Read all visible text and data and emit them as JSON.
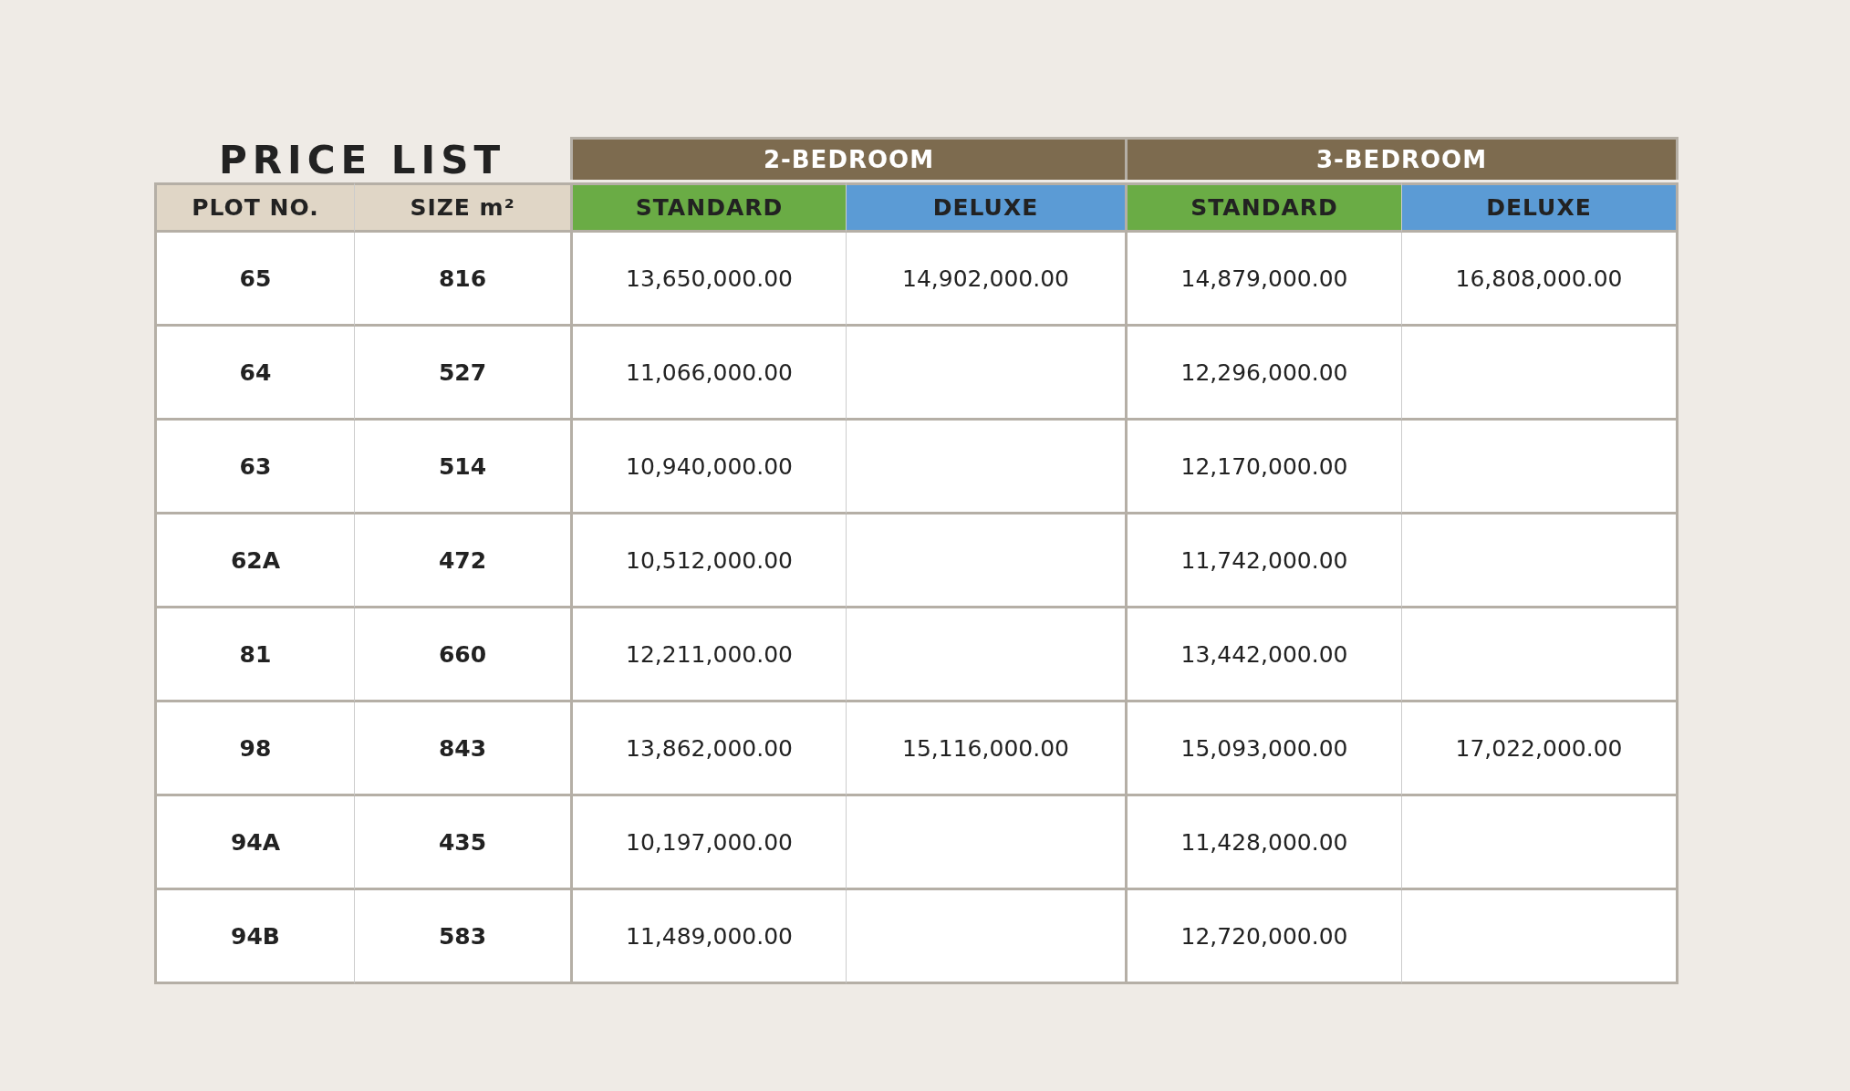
{
  "title": "PRICE LIST",
  "groups": [
    {
      "label": "2-BEDROOM"
    },
    {
      "label": "3-BEDROOM"
    }
  ],
  "columns": [
    {
      "label": "PLOT NO.",
      "kind": "key"
    },
    {
      "label": "SIZE m²",
      "kind": "key"
    },
    {
      "label": "STANDARD",
      "kind": "price",
      "color": "#6aac45"
    },
    {
      "label": "DELUXE",
      "kind": "price",
      "color": "#5b9bd5"
    },
    {
      "label": "STANDARD",
      "kind": "price",
      "color": "#6aac45"
    },
    {
      "label": "DELUXE",
      "kind": "price",
      "color": "#5b9bd5"
    }
  ],
  "rows": [
    {
      "cells": [
        "65",
        "816",
        "13,650,000.00",
        "14,902,000.00",
        "14,879,000.00",
        "16,808,000.00"
      ]
    },
    {
      "cells": [
        "64",
        "527",
        "11,066,000.00",
        null,
        "12,296,000.00",
        null
      ]
    },
    {
      "cells": [
        "63",
        "514",
        "10,940,000.00",
        null,
        "12,170,000.00",
        null
      ]
    },
    {
      "cells": [
        "62A",
        "472",
        "10,512,000.00",
        null,
        "11,742,000.00",
        null
      ]
    },
    {
      "cells": [
        "81",
        "660",
        "12,211,000.00",
        null,
        "13,442,000.00",
        null
      ]
    },
    {
      "cells": [
        "98",
        "843",
        "13,862,000.00",
        "15,116,000.00",
        "15,093,000.00",
        "17,022,000.00"
      ]
    },
    {
      "cells": [
        "94A",
        "435",
        "10,197,000.00",
        null,
        "11,428,000.00",
        null
      ]
    },
    {
      "cells": [
        "94B",
        "583",
        "11,489,000.00",
        null,
        "12,720,000.00",
        null
      ]
    }
  ]
}
